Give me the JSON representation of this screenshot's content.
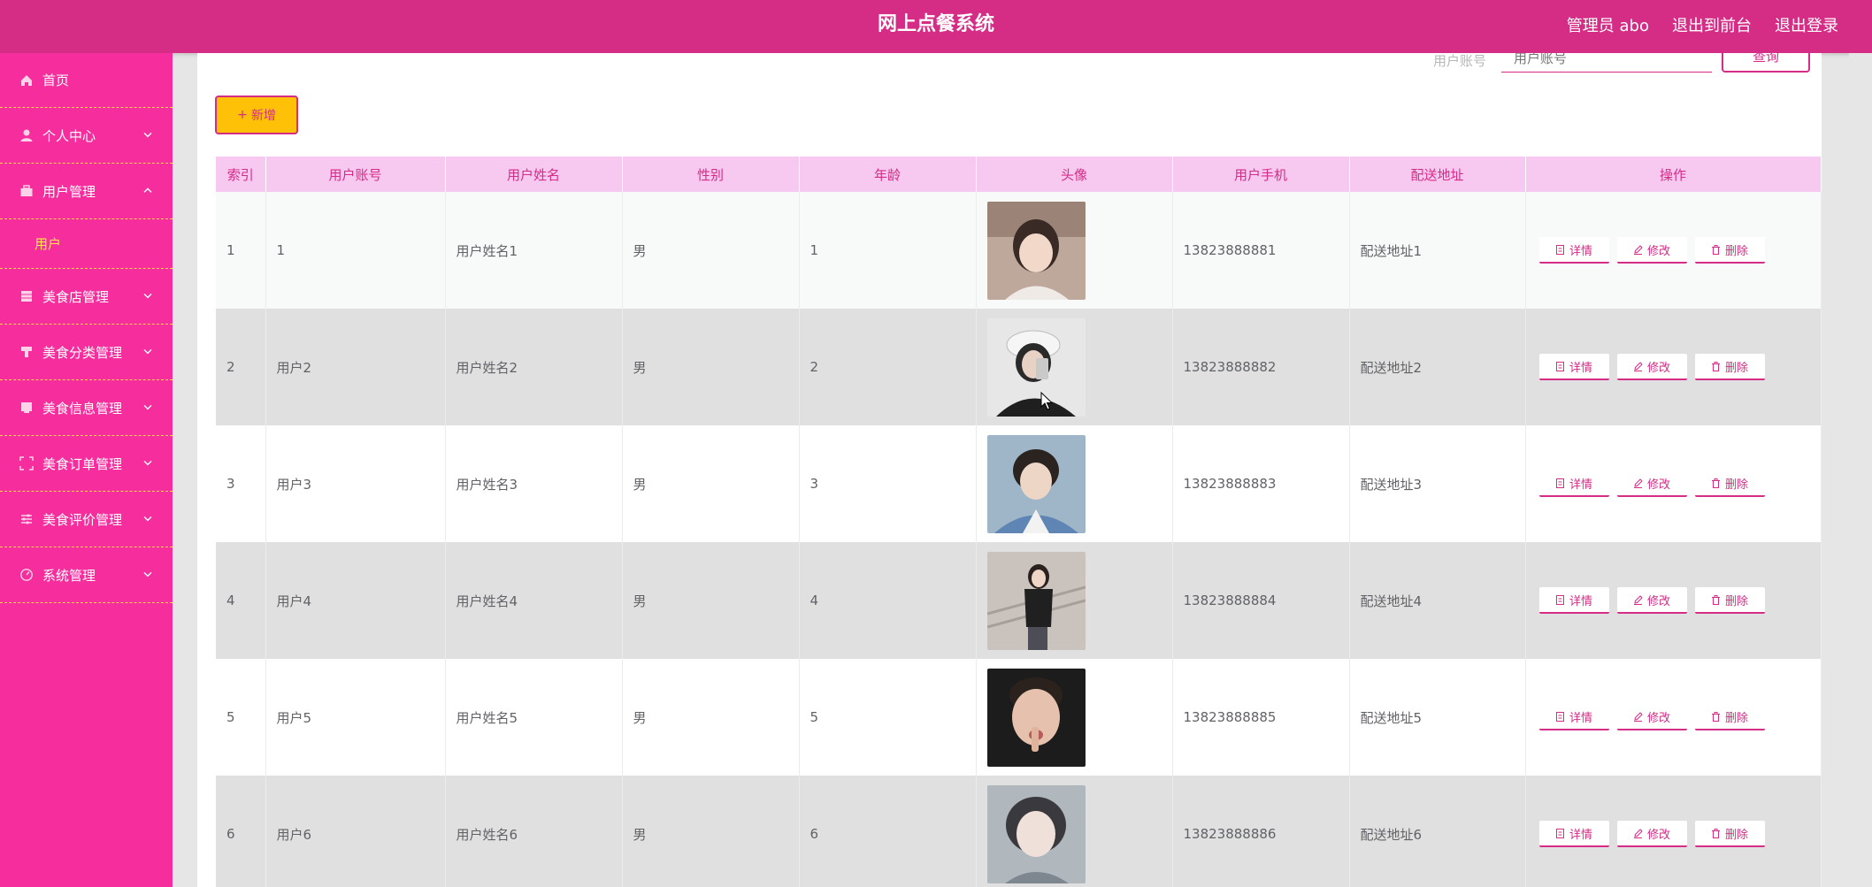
{
  "header": {
    "title": "网上点餐系统",
    "admin_label": "管理员 abo",
    "to_frontend": "退出到前台",
    "logout": "退出登录"
  },
  "sidebar": {
    "items": [
      {
        "label": "首页",
        "icon": "home-icon"
      },
      {
        "label": "个人中心",
        "icon": "user-icon"
      },
      {
        "label": "用户管理",
        "icon": "briefcase-icon"
      },
      {
        "label": "美食店管理",
        "icon": "store-icon"
      },
      {
        "label": "美食分类管理",
        "icon": "category-icon"
      },
      {
        "label": "美食信息管理",
        "icon": "info-icon"
      },
      {
        "label": "美食订单管理",
        "icon": "order-icon"
      },
      {
        "label": "美食评价管理",
        "icon": "review-icon"
      },
      {
        "label": "系统管理",
        "icon": "system-icon"
      }
    ],
    "sub_item": "用户"
  },
  "toolbar": {
    "search_label": "用户账号",
    "search_placeholder": "用户账号",
    "search_button": "查询",
    "add_button": "新增"
  },
  "table": {
    "headers": [
      "索引",
      "用户账号",
      "用户姓名",
      "性别",
      "年龄",
      "头像",
      "用户手机",
      "配送地址",
      "操作"
    ],
    "rows": [
      {
        "index": "1",
        "account": "1",
        "name": "用户姓名1",
        "gender": "男",
        "age": "1",
        "phone": "13823888881",
        "address": "配送地址1"
      },
      {
        "index": "2",
        "account": "用户2",
        "name": "用户姓名2",
        "gender": "男",
        "age": "2",
        "phone": "13823888882",
        "address": "配送地址2"
      },
      {
        "index": "3",
        "account": "用户3",
        "name": "用户姓名3",
        "gender": "男",
        "age": "3",
        "phone": "13823888883",
        "address": "配送地址3"
      },
      {
        "index": "4",
        "account": "用户4",
        "name": "用户姓名4",
        "gender": "男",
        "age": "4",
        "phone": "13823888884",
        "address": "配送地址4"
      },
      {
        "index": "5",
        "account": "用户5",
        "name": "用户姓名5",
        "gender": "男",
        "age": "5",
        "phone": "13823888885",
        "address": "配送地址5"
      },
      {
        "index": "6",
        "account": "用户6",
        "name": "用户姓名6",
        "gender": "男",
        "age": "6",
        "phone": "13823888886",
        "address": "配送地址6"
      }
    ],
    "ops": {
      "detail": "详情",
      "edit": "修改",
      "delete": "删除"
    }
  },
  "colors": {
    "header_bg": "#d52c86",
    "sidebar_bg": "#f52d9d",
    "accent": "#d52c86",
    "add_button_bg": "#ffc107",
    "table_header_bg": "#f7c8f0",
    "submenu_text": "#ffe84a"
  }
}
